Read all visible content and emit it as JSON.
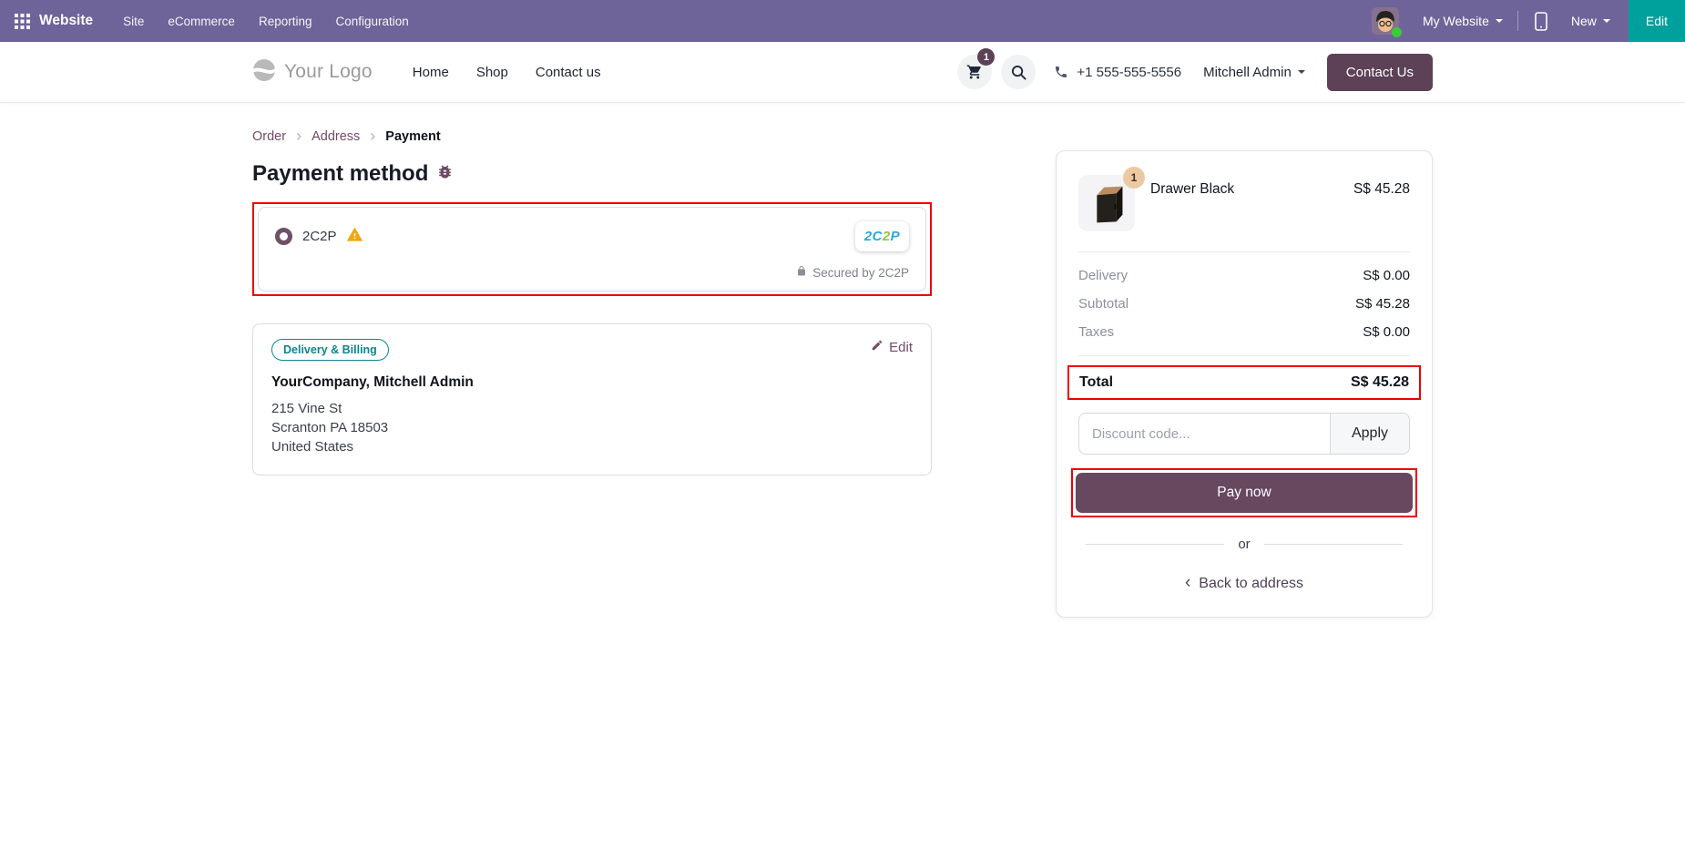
{
  "colors": {
    "topbar": "#6F6499",
    "teal": "#00A09D",
    "plum": "#67485F",
    "plum_dark": "#5D4156",
    "link": "#714B67",
    "red": "#EE0000",
    "warning": "#F0A60E",
    "badge_teal": "#0E8490",
    "tan": "#EDC9A3",
    "c2p_blue": "#2BA7DF",
    "c2p_green": "#8DC63F",
    "online_green": "#3BCB3B"
  },
  "top_nav": {
    "app_label": "Website",
    "menus": [
      "Site",
      "eCommerce",
      "Reporting",
      "Configuration"
    ],
    "my_website": "My Website",
    "new_label": "New",
    "edit_label": "Edit"
  },
  "header": {
    "logo": "Your Logo",
    "nav": [
      "Home",
      "Shop",
      "Contact us"
    ],
    "cart_count": "1",
    "phone": "+1 555-555-5556",
    "user": "Mitchell Admin",
    "contact_button": "Contact Us"
  },
  "breadcrumb": {
    "items": [
      "Order",
      "Address",
      "Payment"
    ],
    "separator": "›"
  },
  "payment": {
    "title": "Payment method",
    "provider": "2C2P",
    "logo_letters": [
      "2",
      "C",
      "2",
      "P"
    ],
    "secured_text": "Secured by 2C2P"
  },
  "address_card": {
    "badge": "Delivery & Billing",
    "edit_label": "Edit",
    "name": "YourCompany, Mitchell Admin",
    "lines": [
      "215 Vine St",
      "Scranton PA 18503",
      "United States"
    ]
  },
  "summary": {
    "qty_badge": "1",
    "product_name": "Drawer Black",
    "product_price": "S$ 45.28",
    "rows": [
      {
        "label": "Delivery",
        "value": "S$ 0.00"
      },
      {
        "label": "Subtotal",
        "value": "S$ 45.28"
      },
      {
        "label": "Taxes",
        "value": "S$ 0.00"
      }
    ],
    "total_label": "Total",
    "total_value": "S$ 45.28",
    "discount_placeholder": "Discount code...",
    "apply_label": "Apply",
    "pay_now_label": "Pay now",
    "or_label": "or",
    "back_chevron": "‹",
    "back_label": "Back to address"
  }
}
